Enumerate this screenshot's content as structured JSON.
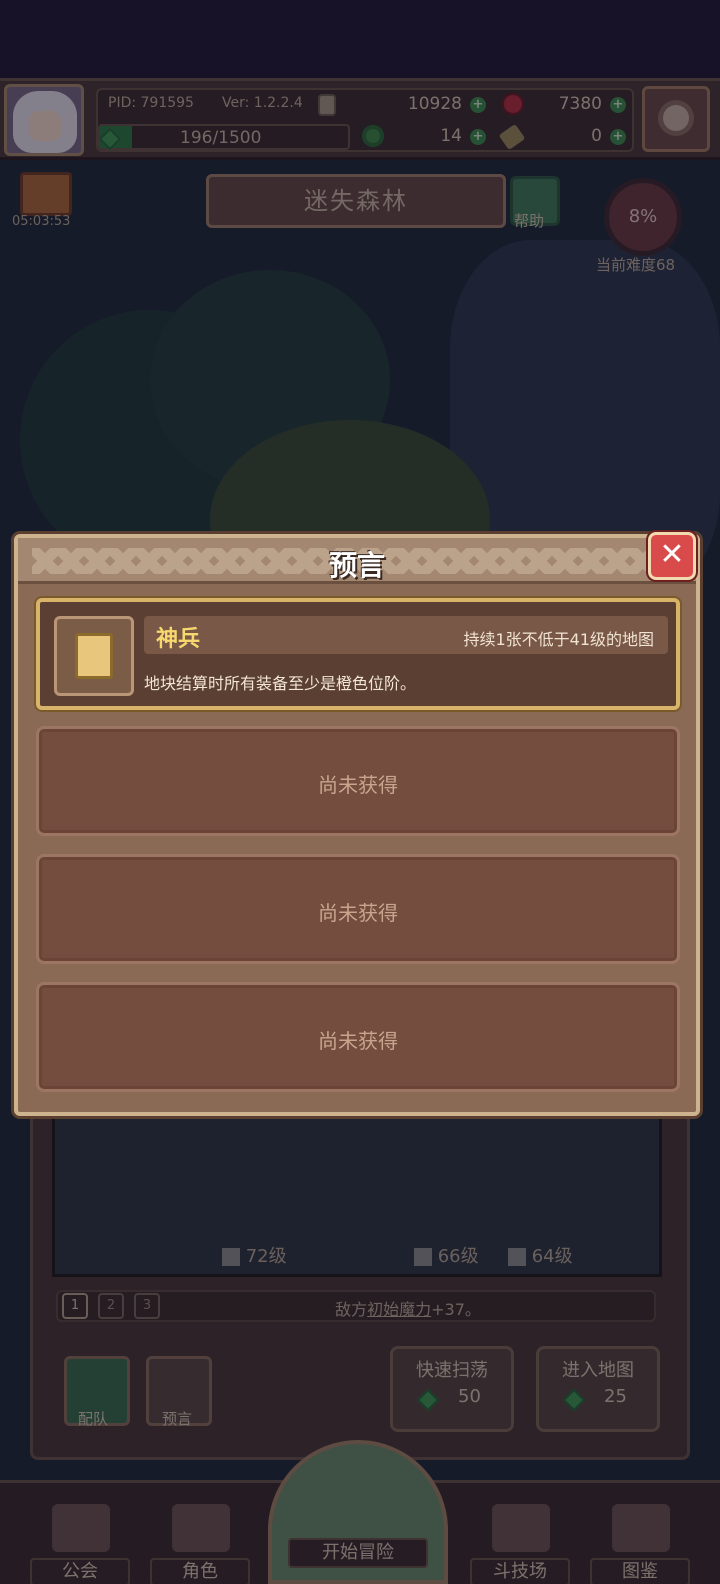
{
  "header": {
    "pid": "PID: 791595",
    "version": "Ver: 1.2.2.4",
    "gold": "10928",
    "red_gem": "7380",
    "stamina": "196/1500",
    "clover": "14",
    "key": "0",
    "stamina_fraction": 0.131
  },
  "stage": {
    "gift_timer": "05:03:53",
    "name": "迷失森林",
    "help_label": "帮助",
    "difficulty_pct": "8%",
    "difficulty_label": "当前难度68"
  },
  "modal": {
    "title": "预言",
    "close_icon": "close-x-icon",
    "prophecy": {
      "name": "神兵",
      "condition": "持续1张不低于41级的地图",
      "description": "地块结算时所有装备至少是橙色位阶。",
      "icon": "scroll-icon"
    },
    "slots": [
      {
        "label": "尚未获得"
      },
      {
        "label": "尚未获得"
      },
      {
        "label": "尚未获得"
      }
    ]
  },
  "party": {
    "level_a": "72级",
    "level_b": "66级",
    "level_c": "64级",
    "pages": [
      "1",
      "2",
      "3"
    ],
    "bonus_prefix": "敌方",
    "bonus_highlight": "初始魔力",
    "bonus_suffix": "+37。"
  },
  "actions": {
    "formation_label": "配队",
    "prophecy_label": "预言",
    "sweep_label": "快速扫荡",
    "sweep_cost": "50",
    "enter_label": "进入地图",
    "enter_cost": "25"
  },
  "nav": {
    "guild": "公会",
    "character": "角色",
    "start": "开始冒险",
    "arena": "斗技场",
    "codex": "图鉴"
  },
  "colors": {
    "accent_gold": "#f6d86e",
    "close_red": "#d94a4a",
    "panel_brown": "#744d3e"
  }
}
